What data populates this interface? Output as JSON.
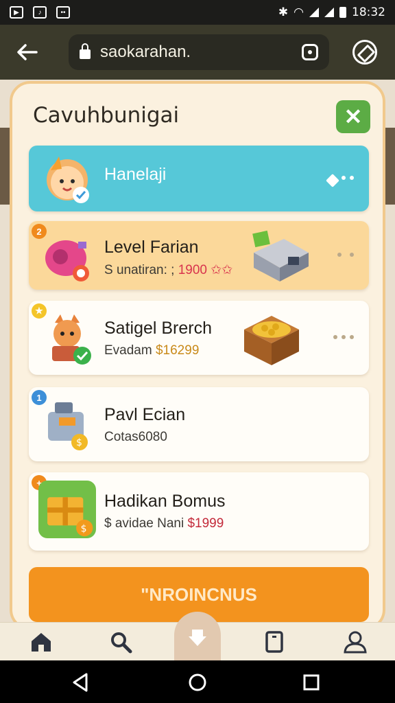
{
  "status_bar": {
    "time": "18:32"
  },
  "browser": {
    "url": "saokarahan."
  },
  "modal": {
    "title": "Cavuhbunigai",
    "cards": [
      {
        "title": "Hanelaji",
        "subtitle": "",
        "price": "",
        "badge": ""
      },
      {
        "title": "Level Farian",
        "subtitle": "S unatiran: ;",
        "price": "1900",
        "badge": "2"
      },
      {
        "title": "Satigel Brerch",
        "subtitle": "Evadam",
        "price": "$16299",
        "badge": "★"
      },
      {
        "title": "Pavl Ecian",
        "subtitle": "Cotas6080",
        "price": "",
        "badge": "1"
      },
      {
        "title": "Hadikan Bomus",
        "subtitle": "$ avidae Nani",
        "price": "$1999",
        "badge": "+"
      }
    ],
    "cta_label": "\"NROINCNUS"
  },
  "nav": {
    "items": [
      "home-icon",
      "search-icon",
      "download-icon",
      "document-icon",
      "profile-icon"
    ]
  },
  "colors": {
    "accent": "#f3931e",
    "teal": "#56c8d8",
    "close": "#5cac45"
  }
}
